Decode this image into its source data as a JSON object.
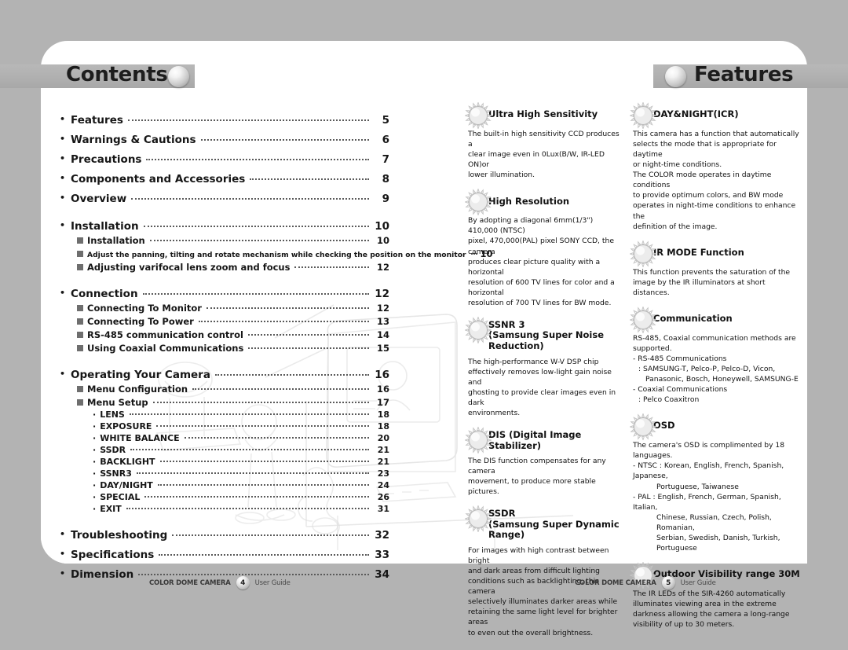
{
  "pages": {
    "left": {
      "tab_title": "Contents",
      "orb_icon": "sphere-orb-icon",
      "footer": {
        "brand": "COLOR DOME CAMERA",
        "page": "4",
        "suffix": "User Guide"
      },
      "toc": [
        {
          "level": 1,
          "label": "Features",
          "page": "5"
        },
        {
          "level": 1,
          "label": "Warnings & Cautions",
          "page": "6"
        },
        {
          "level": 1,
          "label": "Precautions",
          "page": "7"
        },
        {
          "level": 1,
          "label": "Components and Accessories",
          "page": "8"
        },
        {
          "level": 1,
          "label": "Overview",
          "page": "9"
        },
        {
          "level": 1,
          "label": "Installation",
          "page": "10",
          "gap_before": true
        },
        {
          "level": 2,
          "label": "Installation",
          "page": "10"
        },
        {
          "level": 2,
          "label": "Adjust the panning, tilting and rotate mechanism while checking the position on the monitor",
          "page": "10",
          "tight": true
        },
        {
          "level": 2,
          "label": "Adjusting varifocal lens zoom and focus",
          "page": "12"
        },
        {
          "level": 1,
          "label": "Connection",
          "page": "12",
          "gap_before": true
        },
        {
          "level": 2,
          "label": "Connecting To Monitor",
          "page": "12"
        },
        {
          "level": 2,
          "label": "Connecting To Power",
          "page": "13"
        },
        {
          "level": 2,
          "label": "RS-485 communication control",
          "page": "14"
        },
        {
          "level": 2,
          "label": "Using Coaxial Communications",
          "page": "15"
        },
        {
          "level": 1,
          "label": "Operating Your Camera",
          "page": "16",
          "gap_before": true
        },
        {
          "level": 2,
          "label": "Menu Configuration",
          "page": "16"
        },
        {
          "level": 2,
          "label": "Menu Setup",
          "page": "17"
        },
        {
          "level": 3,
          "label": "LENS",
          "page": "18"
        },
        {
          "level": 3,
          "label": "EXPOSURE",
          "page": "18"
        },
        {
          "level": 3,
          "label": "WHITE BALANCE",
          "page": "20"
        },
        {
          "level": 3,
          "label": "SSDR",
          "page": "21"
        },
        {
          "level": 3,
          "label": "BACKLIGHT",
          "page": "21"
        },
        {
          "level": 3,
          "label": "SSNR3",
          "page": "23"
        },
        {
          "level": 3,
          "label": "DAY/NIGHT",
          "page": "24"
        },
        {
          "level": 3,
          "label": "SPECIAL",
          "page": "26"
        },
        {
          "level": 3,
          "label": "EXIT",
          "page": "31"
        },
        {
          "level": 1,
          "label": "Troubleshooting",
          "page": "32",
          "gap_before": true
        },
        {
          "level": 1,
          "label": "Specifications",
          "page": "33"
        },
        {
          "level": 1,
          "label": "Dimension",
          "page": "34"
        }
      ]
    },
    "right": {
      "tab_title": "Features",
      "orb_icon": "sphere-orb-icon",
      "footer": {
        "brand": "COLOR DOME CAMERA",
        "page": "5",
        "suffix": "User Guide"
      },
      "column_left": [
        {
          "icon": "sunburst-icon",
          "heading": "Ultra High Sensitivity",
          "body": [
            {
              "text": "The built-in high sensitivity CCD produces a"
            },
            {
              "text": "clear image even in 0Lux(B/W, IR-LED ON)or"
            },
            {
              "text": "lower illumination."
            }
          ]
        },
        {
          "icon": "sunburst-icon",
          "heading": "High Resolution",
          "body": [
            {
              "text": "By adopting a diagonal 6mm(1/3\") 410,000 (NTSC)"
            },
            {
              "text": "pixel, 470,000(PAL) pixel SONY CCD, the camera"
            },
            {
              "text": "produces clear picture quality with a horizontal"
            },
            {
              "text": "resolution of 600 TV lines for color and a horizontal"
            },
            {
              "text": "resolution of 700 TV lines for BW mode."
            }
          ]
        },
        {
          "icon": "sunburst-icon",
          "heading": "SSNR 3",
          "heading2": "(Samsung Super Noise Reduction)",
          "body": [
            {
              "text": "The high-performance W-V DSP chip"
            },
            {
              "text": "effectively removes low-light gain noise and"
            },
            {
              "text": "ghosting to provide clear images even in dark"
            },
            {
              "text": "environments."
            }
          ]
        },
        {
          "icon": "sunburst-icon",
          "heading": "DIS (Digital Image Stabilizer)",
          "body": [
            {
              "text": "The DIS function compensates for any camera"
            },
            {
              "text": "movement, to produce more stable pictures."
            }
          ]
        },
        {
          "icon": "sunburst-icon",
          "heading": "SSDR",
          "heading2": "(Samsung Super Dynamic Range)",
          "body": [
            {
              "text": "For images with high contrast between bright"
            },
            {
              "text": "and dark areas from difficult lighting"
            },
            {
              "text": "conditions such as backlighting, this camera"
            },
            {
              "text": "selectively illuminates darker areas while"
            },
            {
              "text": "retaining the same light level for brighter areas"
            },
            {
              "text": "to even out the overall brightness."
            }
          ]
        }
      ],
      "column_right": [
        {
          "icon": "sunburst-icon",
          "heading": "DAY&NIGHT(ICR)",
          "body": [
            {
              "text": "This camera has a function that automatically"
            },
            {
              "text": "selects the mode that is appropriate for daytime"
            },
            {
              "text": "or night-time conditions."
            },
            {
              "text": "The COLOR mode operates in daytime conditions"
            },
            {
              "text": "to provide optimum colors, and BW mode"
            },
            {
              "text": "operates in night-time conditions to enhance the"
            },
            {
              "text": "definition of the image."
            }
          ]
        },
        {
          "icon": "sunburst-icon",
          "heading": "IR MODE Function",
          "body": [
            {
              "text": "This function prevents the saturation of the"
            },
            {
              "text": "image by the IR illuminators at short distances."
            }
          ]
        },
        {
          "icon": "sunburst-icon",
          "heading": "Communication",
          "body": [
            {
              "text": "RS-485, Coaxial communication methods are"
            },
            {
              "text": "supported."
            },
            {
              "text": "- RS-485 Communications"
            },
            {
              "text": ": SAMSUNG-T, Pelco-P, Pelco-D, Vicon,",
              "indent": 1
            },
            {
              "text": "Panasonic, Bosch, Honeywell, SAMSUNG-E",
              "indent": 2
            },
            {
              "text": "- Coaxial Communications"
            },
            {
              "text": ": Pelco Coaxitron",
              "indent": 1
            }
          ]
        },
        {
          "icon": "sunburst-icon",
          "heading": "OSD",
          "body": [
            {
              "text": "The camera's OSD is complimented by 18 languages."
            },
            {
              "text": "- NTSC : Korean, English, French, Spanish, Japanese,"
            },
            {
              "text": "Portuguese, Taiwanese",
              "indent": 3
            },
            {
              "text": "- PAL : English, French, German, Spanish, Italian,"
            },
            {
              "text": "Chinese, Russian, Czech, Polish, Romanian,",
              "indent": 3
            },
            {
              "text": "Serbian, Swedish, Danish, Turkish, Portuguese",
              "indent": 3
            }
          ]
        },
        {
          "icon": "sunburst-icon",
          "heading": "Outdoor Visibility range 30M",
          "body": [
            {
              "text": "The IR LEDs of the SIR-4260 automatically"
            },
            {
              "text": "illuminates viewing area in the extreme"
            },
            {
              "text": "darkness allowing the camera a long-range"
            },
            {
              "text": "visibility of up to 30 meters."
            }
          ]
        }
      ]
    }
  },
  "colors": {
    "page_background": "#b3b3b3",
    "sheet": "#ffffff",
    "tab_bar": "#b0b0b0",
    "text": "#161616",
    "bullet_square": "#6e6e6e"
  }
}
